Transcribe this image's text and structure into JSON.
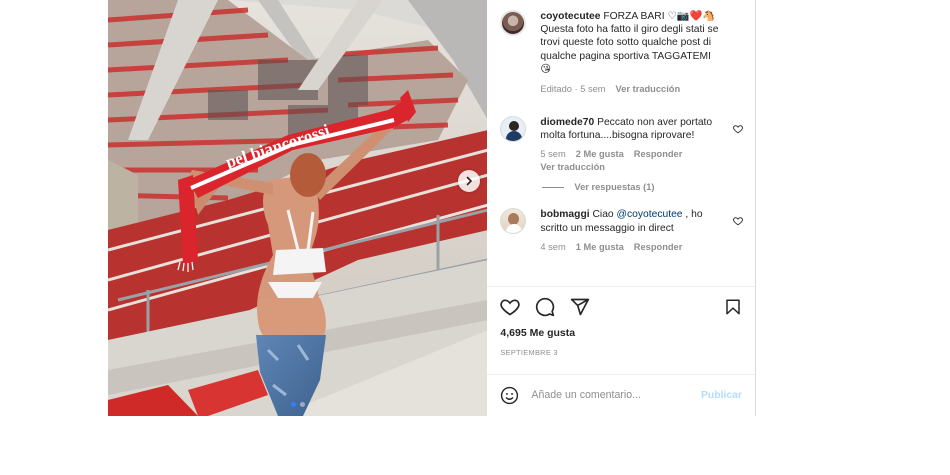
{
  "post": {
    "caption": {
      "username": "coyotecutee",
      "text": "FORZA BARI ♡📷❤️🐴 Questa foto ha fatto il giro degli stati se trovi queste foto sotto qualche post di qualche pagina sportiva TAGGATEMI 😘",
      "edited": "Editado",
      "time": "5 sem",
      "see_translation": "Ver traducción"
    },
    "comments": [
      {
        "username": "diomede70",
        "text": "Peccato non aver portato molta fortuna....bisogna riprovare!",
        "time": "5 sem",
        "likes": "2 Me gusta",
        "reply": "Responder",
        "see_translation": "Ver traducción",
        "view_replies": "Ver respuestas (1)"
      },
      {
        "username": "bobmaggi",
        "text_prefix": "Ciao",
        "mention": "@coyotecutee",
        "text_suffix": ", ho scritto un messaggio in direct",
        "time": "4 sem",
        "likes": "1 Me gusta",
        "reply": "Responder"
      }
    ],
    "likes_count": "4,695 Me gusta",
    "date": "SEPTIEMBRE 3",
    "add_comment_placeholder": "Añade un comentario...",
    "publish_label": "Publicar",
    "carousel": {
      "slides": 2,
      "active_slide": 1
    },
    "scarf_text": "pel biancorossi"
  },
  "colors": {
    "link": "#00376b",
    "muted": "#8e8e8e",
    "publish_disabled": "#b3dbff",
    "dot_active": "#2f80ff",
    "scarf_red": "#d9252b"
  },
  "icons": [
    "chevron-right-icon",
    "heart-icon",
    "comment-icon",
    "share-icon",
    "bookmark-icon",
    "emoji-icon"
  ]
}
